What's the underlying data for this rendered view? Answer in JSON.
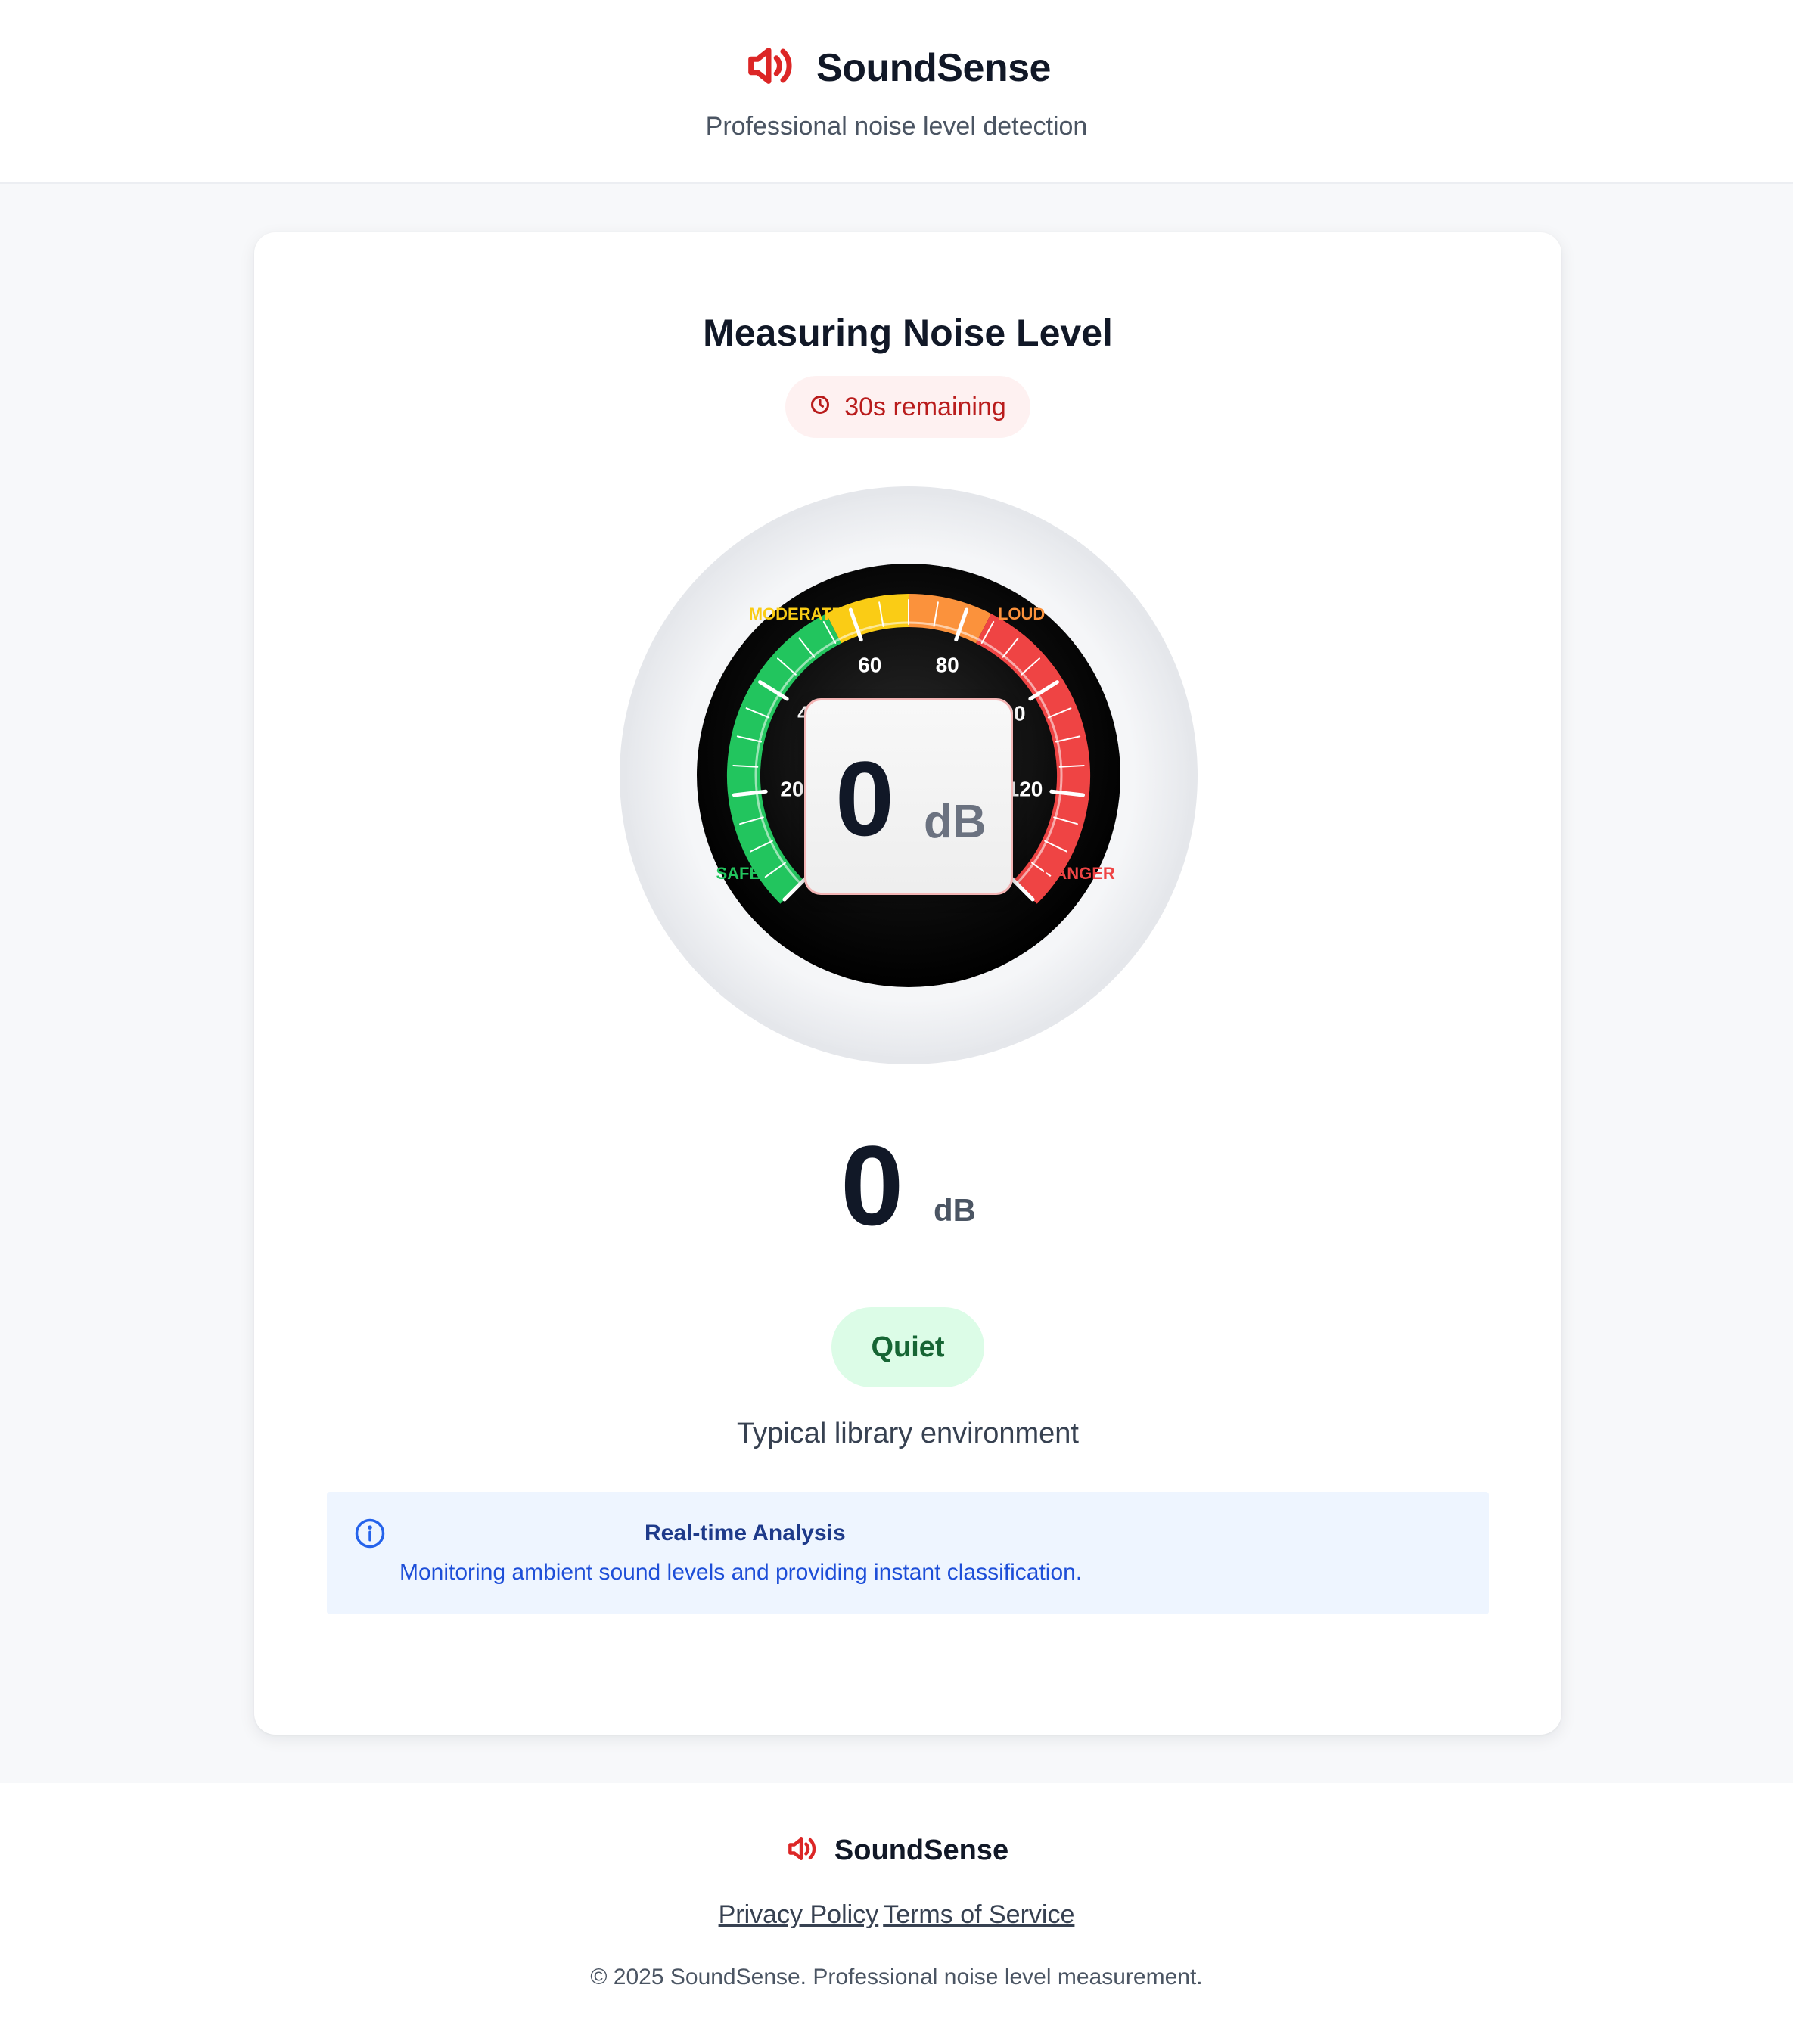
{
  "header": {
    "brand_name": "SoundSense",
    "tagline": "Professional noise level detection",
    "logo_icon": "speaker-wave-icon",
    "accent_color": "#dc2626"
  },
  "card": {
    "title": "Measuring Noise Level",
    "timer_icon": "clock-icon",
    "timer_text": "30s remaining"
  },
  "gauge": {
    "value": 0,
    "unit": "dB",
    "scale_min": 0,
    "scale_max": 140,
    "tick_labels": [
      "20",
      "40",
      "60",
      "80",
      "100",
      "120"
    ],
    "zone_labels": [
      "SAFE",
      "MODERATE",
      "LOUD",
      "DANGER"
    ],
    "zone_colors": [
      "#22c55e",
      "#facc15",
      "#fb923c",
      "#ef4444"
    ]
  },
  "reading": {
    "value": "0",
    "unit": "dB",
    "classification": "Quiet",
    "description": "Typical library environment",
    "classification_color": "#166534"
  },
  "info": {
    "icon": "info-circle-icon",
    "title": "Real-time Analysis",
    "text": "Monitoring ambient sound levels and providing instant classification."
  },
  "footer": {
    "brand_name": "SoundSense",
    "links": [
      "Privacy Policy",
      "Terms of Service"
    ],
    "copyright": "© 2025 SoundSense. Professional noise level measurement."
  }
}
